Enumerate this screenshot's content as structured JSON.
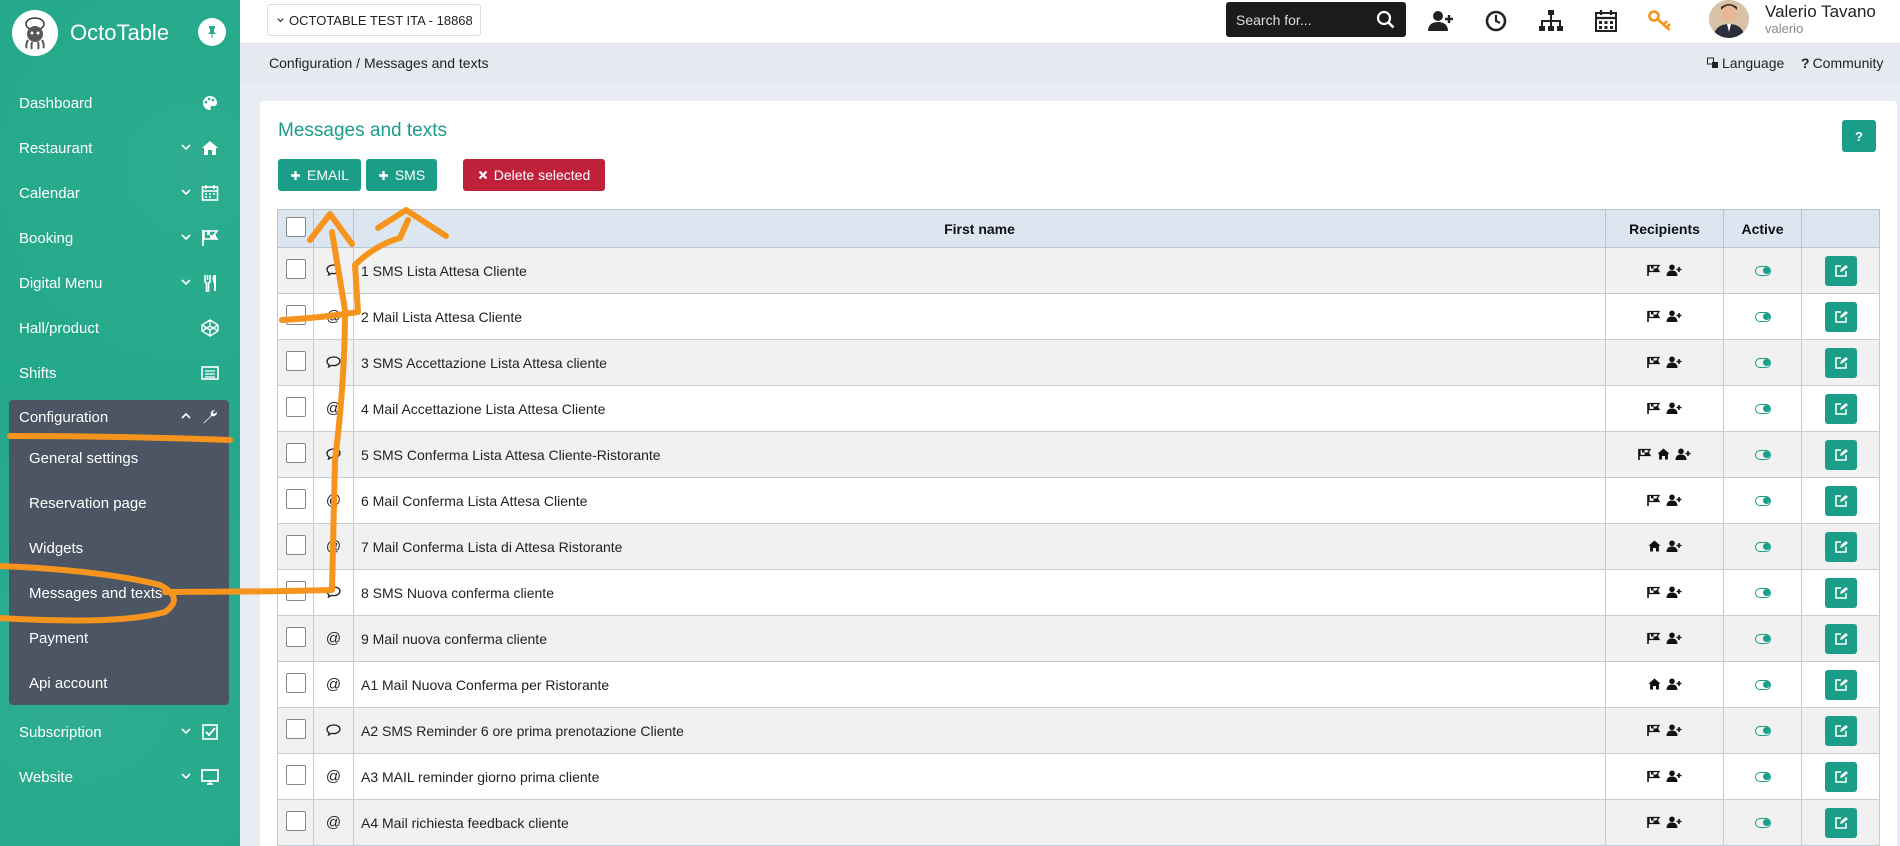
{
  "brand": {
    "name": "OctoTable"
  },
  "sidebar": {
    "items": [
      {
        "label": "Dashboard",
        "icon": "palette-icon",
        "chevron": false
      },
      {
        "label": "Restaurant",
        "icon": "home-icon",
        "chevron": true
      },
      {
        "label": "Calendar",
        "icon": "calendar-icon",
        "chevron": true
      },
      {
        "label": "Booking",
        "icon": "flag-icon",
        "chevron": true
      },
      {
        "label": "Digital Menu",
        "icon": "cutlery-icon",
        "chevron": true
      },
      {
        "label": "Hall/product",
        "icon": "codepen-icon",
        "chevron": false
      },
      {
        "label": "Shifts",
        "icon": "list-icon",
        "chevron": false
      },
      {
        "label": "Configuration",
        "icon": "wrench-icon",
        "chevron": true,
        "expanded": true
      },
      {
        "label": "Subscription",
        "icon": "check-square-icon",
        "chevron": true
      },
      {
        "label": "Website",
        "icon": "desktop-icon",
        "chevron": true
      }
    ],
    "config_sub": [
      {
        "label": "General settings"
      },
      {
        "label": "Reservation page"
      },
      {
        "label": "Widgets"
      },
      {
        "label": "Messages and texts",
        "active": true
      },
      {
        "label": "Payment"
      },
      {
        "label": "Api account"
      }
    ]
  },
  "topbar": {
    "restaurant": "OCTOTABLE TEST ITA - 18868",
    "search_placeholder": "Search for...",
    "icons": [
      "add-user-icon",
      "clock-icon",
      "sitemap-icon",
      "calendar-icon",
      "key-icon"
    ],
    "user_name": "Valerio Tavano",
    "user_login": "valerio"
  },
  "breadcrumb": {
    "path": "Configuration / Messages and texts",
    "language": "Language",
    "community": "Community"
  },
  "panel": {
    "title": "Messages and texts",
    "help": "?",
    "btn_email": "EMAIL",
    "btn_sms": "SMS",
    "btn_delete": "Delete selected"
  },
  "table": {
    "headers": {
      "name": "First name",
      "recipients": "Recipients",
      "active": "Active"
    },
    "rows": [
      {
        "type": "sms",
        "name": "1 SMS Lista Attesa Cliente",
        "recipients": [
          "flag",
          "user"
        ]
      },
      {
        "type": "mail",
        "name": "2 Mail Lista Attesa Cliente",
        "recipients": [
          "flag",
          "user"
        ]
      },
      {
        "type": "sms",
        "name": "3 SMS Accettazione Lista Attesa cliente",
        "recipients": [
          "flag",
          "user"
        ]
      },
      {
        "type": "mail",
        "name": "4 Mail Accettazione Lista Attesa Cliente",
        "recipients": [
          "flag",
          "user"
        ]
      },
      {
        "type": "sms",
        "name": "5 SMS Conferma Lista Attesa Cliente-Ristorante",
        "recipients": [
          "flag",
          "home",
          "user"
        ]
      },
      {
        "type": "mail",
        "name": "6 Mail Conferma Lista Attesa Cliente",
        "recipients": [
          "flag",
          "user"
        ]
      },
      {
        "type": "mail",
        "name": "7 Mail Conferma Lista di Attesa Ristorante",
        "recipients": [
          "home",
          "user"
        ]
      },
      {
        "type": "sms",
        "name": "8 SMS Nuova conferma cliente",
        "recipients": [
          "flag",
          "user"
        ]
      },
      {
        "type": "mail",
        "name": "9 Mail nuova conferma cliente",
        "recipients": [
          "flag",
          "user"
        ]
      },
      {
        "type": "mail",
        "name": "A1 Mail Nuova Conferma per Ristorante",
        "recipients": [
          "home",
          "user"
        ]
      },
      {
        "type": "sms",
        "name": "A2 SMS Reminder 6 ore prima prenotazione Cliente",
        "recipients": [
          "flag",
          "user"
        ]
      },
      {
        "type": "mail",
        "name": "A3 MAIL reminder giorno prima cliente",
        "recipients": [
          "flag",
          "user"
        ]
      },
      {
        "type": "mail",
        "name": "A4 Mail richiesta feedback cliente",
        "recipients": [
          "flag",
          "user"
        ]
      }
    ]
  },
  "colors": {
    "sidebar": "#22a88a",
    "accent": "#1a9e88",
    "danger": "#c0213a",
    "annotation": "#f7941d"
  }
}
